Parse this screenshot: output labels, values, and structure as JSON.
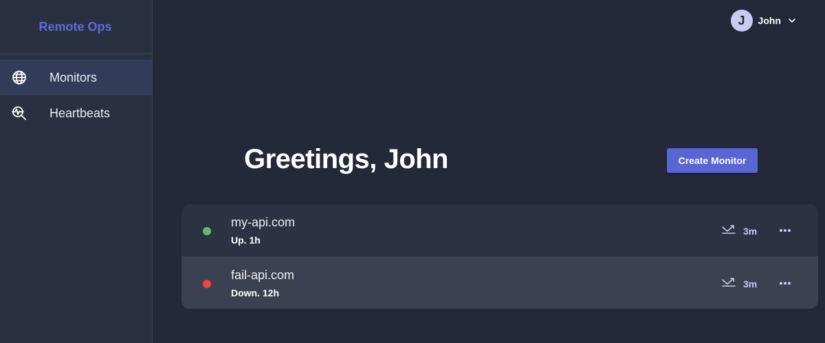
{
  "app": {
    "brand": "Remote Ops"
  },
  "sidebar": {
    "items": [
      {
        "label": "Monitors",
        "icon": "globe-icon",
        "active": true
      },
      {
        "label": "Heartbeats",
        "icon": "heartbeat-search-icon",
        "active": false
      }
    ]
  },
  "user": {
    "initial": "J",
    "name": "John"
  },
  "main": {
    "greeting": "Greetings, John",
    "create_label": "Create Monitor"
  },
  "monitors": [
    {
      "name": "my-api.com",
      "status": "Up. 1h",
      "status_color": "#66bb6a",
      "interval": "3m"
    },
    {
      "name": "fail-api.com",
      "status": "Down. 12h",
      "status_color": "#f44336",
      "interval": "3m"
    }
  ],
  "colors": {
    "accent": "#5a65d4",
    "brand": "#5c6bd6",
    "background": "#232939",
    "sidebar": "#293141"
  }
}
